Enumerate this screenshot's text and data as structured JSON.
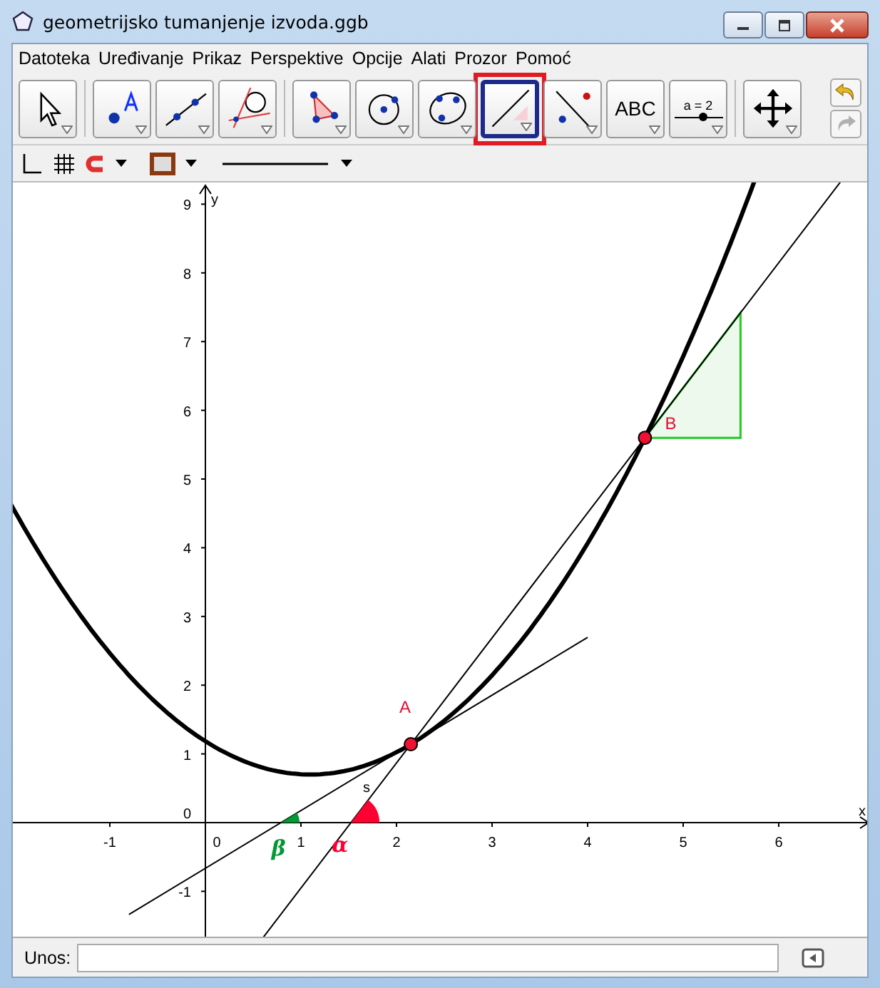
{
  "window": {
    "title": "geometrijsko tumanjenje izvoda.ggb"
  },
  "menu": [
    "Datoteka",
    "Uređivanje",
    "Prikaz",
    "Perspektive",
    "Opcije",
    "Alati",
    "Prozor",
    "Pomoć"
  ],
  "toolbar": {
    "groups": [
      {
        "tools": [
          {
            "kind": "move",
            "selected": false,
            "highlighted": false
          }
        ]
      },
      {
        "tools": [
          {
            "kind": "point",
            "selected": false,
            "highlighted": false
          },
          {
            "kind": "line",
            "selected": false,
            "highlighted": false
          },
          {
            "kind": "tangent",
            "selected": false,
            "highlighted": false
          }
        ]
      },
      {
        "tools": [
          {
            "kind": "polygon",
            "selected": false,
            "highlighted": false
          },
          {
            "kind": "circle",
            "selected": false,
            "highlighted": false
          },
          {
            "kind": "conic",
            "selected": false,
            "highlighted": false
          },
          {
            "kind": "slope",
            "selected": true,
            "highlighted": true
          },
          {
            "kind": "reflect",
            "selected": false,
            "highlighted": false
          },
          {
            "kind": "text",
            "selected": false,
            "highlighted": false,
            "label": "ABC"
          },
          {
            "kind": "slider",
            "selected": false,
            "highlighted": false,
            "label": "a = 2"
          }
        ]
      },
      {
        "tools": [
          {
            "kind": "pan",
            "selected": false,
            "highlighted": false
          }
        ]
      }
    ],
    "undo": {
      "disabled": false
    },
    "redo": {
      "disabled": true
    }
  },
  "graphics": {
    "x_ticks": [
      "-1",
      "0",
      "1",
      "2",
      "3",
      "4",
      "5",
      "6"
    ],
    "y_ticks": [
      "9",
      "8",
      "7",
      "6",
      "5",
      "4",
      "3",
      "2",
      "1",
      "0",
      "-1"
    ],
    "x_axis_label": "x",
    "y_axis_label": "y",
    "points": [
      {
        "label": "A"
      },
      {
        "label": "B"
      }
    ],
    "slope_label": "s",
    "angles": [
      {
        "label": "β",
        "color": "#009933"
      },
      {
        "label": "α",
        "color": "#ff0033"
      }
    ]
  },
  "input_bar": {
    "label": "Unos:"
  }
}
